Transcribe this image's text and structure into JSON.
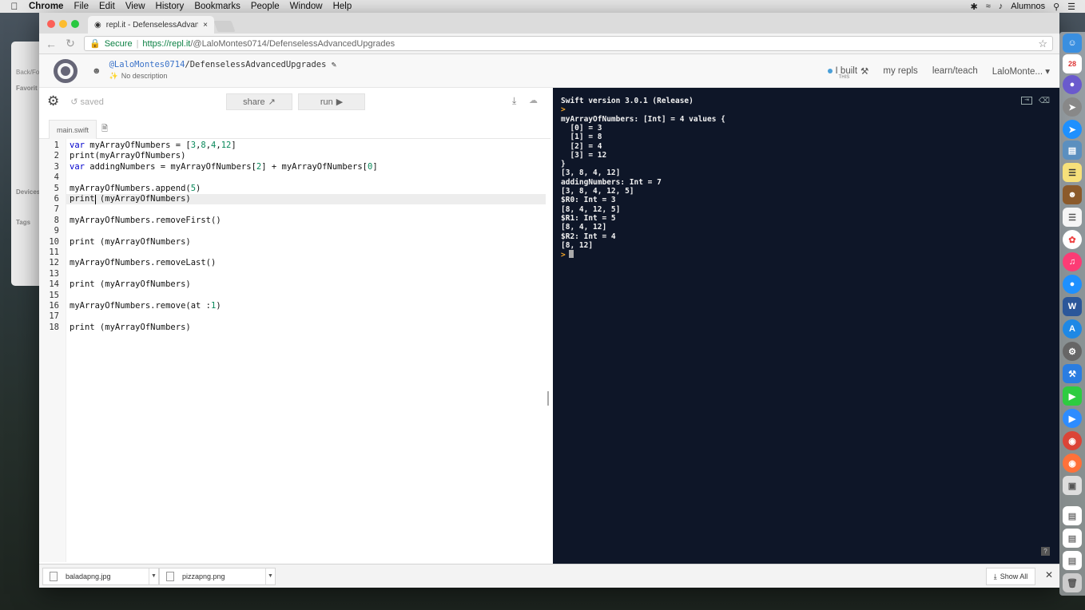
{
  "menubar": {
    "apple": "",
    "items": [
      "Chrome",
      "File",
      "Edit",
      "View",
      "History",
      "Bookmarks",
      "People",
      "Window",
      "Help"
    ],
    "user": "Alumnos"
  },
  "browser": {
    "tab_title": "repl.it - DefenselessAdvancedU",
    "secure_label": "Secure",
    "url_host": "https://repl.it",
    "url_path": "/@LaloMontes0714/DefenselessAdvancedUpgrades"
  },
  "repl": {
    "owner": "@LaloMontes0714",
    "project": "/DefenselessAdvancedUpgrades",
    "description": "No description",
    "nav": {
      "built": "I built",
      "built_sub": "THIS",
      "my_repls": "my repls",
      "learn_teach": "learn/teach",
      "user": "LaloMonte..."
    },
    "saved": "saved",
    "share": "share",
    "run": "run",
    "file_tab": "main.swift"
  },
  "code_lines": [
    "var myArrayOfNumbers = [3,8,4,12]",
    "print(myArrayOfNumbers)",
    "var addingNumbers = myArrayOfNumbers[2] + myArrayOfNumbers[0]",
    "",
    "myArrayOfNumbers.append(5)",
    "print (myArrayOfNumbers)",
    "",
    "myArrayOfNumbers.removeFirst()",
    "",
    "print (myArrayOfNumbers)",
    "",
    "myArrayOfNumbers.removeLast()",
    "",
    "print (myArrayOfNumbers)",
    "",
    "myArrayOfNumbers.remove(at :1)",
    "",
    "print (myArrayOfNumbers)"
  ],
  "console_lines": [
    "Swift version 3.0.1 (Release)",
    ">",
    "myArrayOfNumbers: [Int] = 4 values {",
    "  [0] = 3",
    "  [1] = 8",
    "  [2] = 4",
    "  [3] = 12",
    "}",
    "[3, 8, 4, 12]",
    "addingNumbers: Int = 7",
    "[3, 8, 4, 12, 5]",
    "$R0: Int = 3",
    "[8, 4, 12, 5]",
    "$R1: Int = 5",
    "[8, 4, 12]",
    "$R2: Int = 4",
    "[8, 12]",
    ">"
  ],
  "downloads": {
    "items": [
      "baladapng.jpg",
      "pizzapng.png"
    ],
    "show_all": "Show All"
  },
  "finder": {
    "labels": [
      "Back/Fo",
      "Favorit",
      "Devices",
      "Tags"
    ]
  },
  "colors": {
    "console_bg": "#0e1628",
    "prompt": "#f3a62a",
    "keyword": "#0000cc",
    "number": "#09885a"
  }
}
